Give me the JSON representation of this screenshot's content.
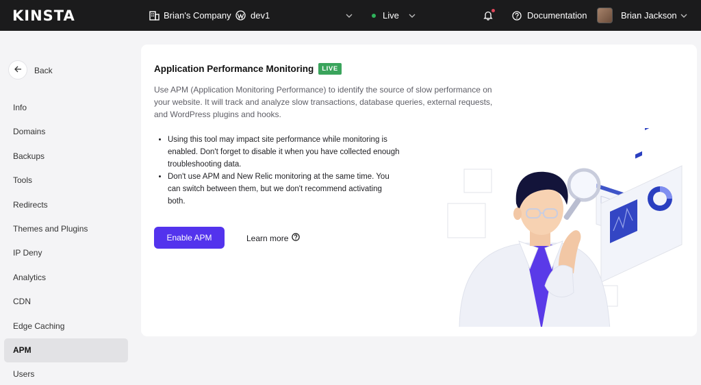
{
  "topbar": {
    "logo": "KINSTA",
    "company": "Brian's Company",
    "site": "dev1",
    "environment": "Live",
    "docs": "Documentation",
    "user": "Brian Jackson"
  },
  "sidebar": {
    "back_label": "Back",
    "items": [
      {
        "label": "Info"
      },
      {
        "label": "Domains"
      },
      {
        "label": "Backups"
      },
      {
        "label": "Tools"
      },
      {
        "label": "Redirects"
      },
      {
        "label": "Themes and Plugins"
      },
      {
        "label": "IP Deny"
      },
      {
        "label": "Analytics"
      },
      {
        "label": "CDN"
      },
      {
        "label": "Edge Caching"
      },
      {
        "label": "APM",
        "active": true
      },
      {
        "label": "Users"
      }
    ]
  },
  "main": {
    "title": "Application Performance Monitoring",
    "badge": "LIVE",
    "description": "Use APM (Application Monitoring Performance) to identify the source of slow performance on your website. It will track and analyze slow transactions, database queries, external requests, and WordPress plugins and hooks.",
    "bullets": [
      "Using this tool may impact site performance while monitoring is enabled. Don't forget to disable it when you have collected enough troubleshooting data.",
      "Don't use APM and New Relic monitoring at the same time. You can switch between them, but we don't recommend activating both."
    ],
    "enable_label": "Enable APM",
    "learn_more_label": "Learn more"
  },
  "colors": {
    "accent": "#5333ed",
    "live_badge": "#3aa45c",
    "status_dot": "#2fb35b",
    "topbar": "#1b1b1c"
  },
  "icons": [
    "building-icon",
    "wordpress-icon",
    "chevron-down-icon",
    "bell-icon",
    "help-circle-icon",
    "arrow-left-icon"
  ]
}
